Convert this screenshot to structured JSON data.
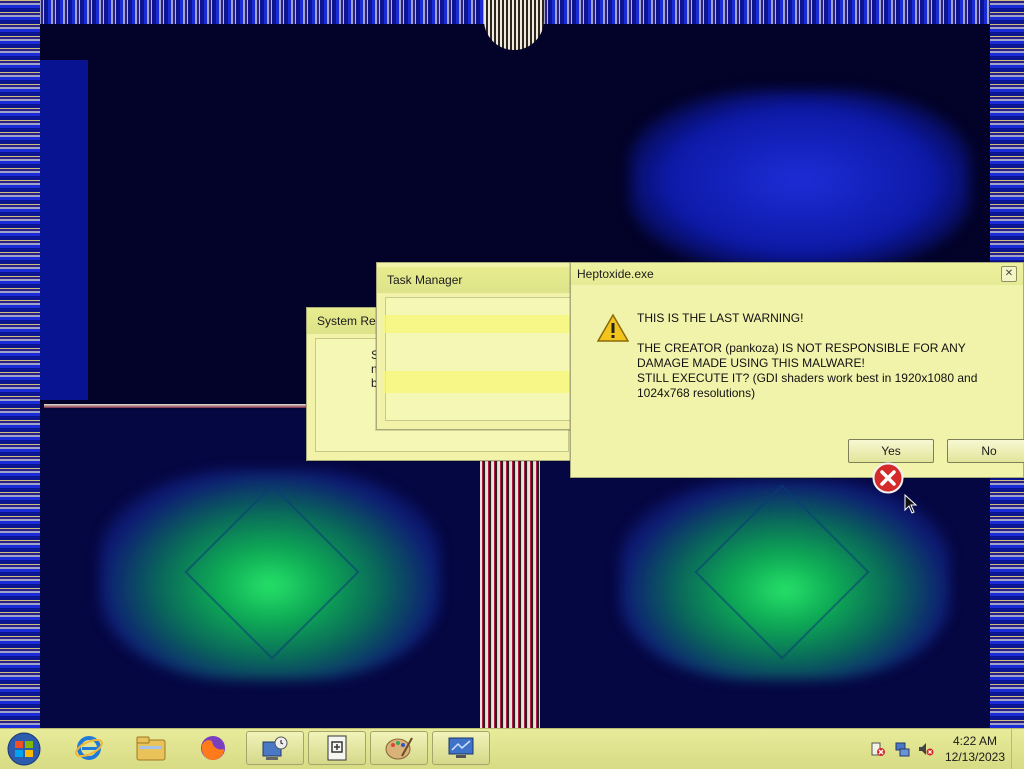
{
  "windows": {
    "system_restore": {
      "title": "System Restore",
      "visible_text": "S\nn\nb"
    },
    "task_manager": {
      "title": "Task Manager"
    },
    "message_box": {
      "title": "Heptoxide.exe",
      "close_glyph": "✕",
      "line1": "THIS IS THE LAST WARNING!",
      "line2": "THE CREATOR (pankoza) IS NOT RESPONSIBLE FOR ANY DAMAGE MADE USING THIS MALWARE!",
      "line3": "STILL EXECUTE IT? (GDI shaders work best in 1920x1080 and 1024x768 resolutions)",
      "yes_label": "Yes",
      "no_label": "No",
      "icon": "warning-icon"
    }
  },
  "overlay_icons": {
    "error": "error-icon",
    "cursor": "mouse-pointer-icon"
  },
  "taskbar": {
    "start": "windows-start-orb",
    "pinned": [
      {
        "name": "internet-explorer-icon",
        "open": false
      },
      {
        "name": "file-explorer-icon",
        "open": false
      },
      {
        "name": "firefox-icon",
        "open": false
      },
      {
        "name": "system-restore-icon",
        "open": true
      },
      {
        "name": "task-manager-icon",
        "open": true
      },
      {
        "name": "paint-icon",
        "open": true
      },
      {
        "name": "network-app-icon",
        "open": true
      }
    ],
    "tray_icons": [
      "action-center-icon",
      "network-icon",
      "volume-muted-icon"
    ],
    "time": "4:22 AM",
    "date": "12/13/2023"
  },
  "colors": {
    "window_tint": "#f2f3a8",
    "taskbar_tint": "#e0e38f",
    "desktop_background": "#04063a",
    "glow_green": "#27e36a"
  }
}
